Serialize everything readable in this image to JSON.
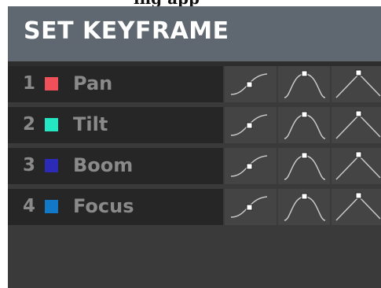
{
  "top_fragment": "ing app",
  "panel": {
    "title": "SET KEYFRAME"
  },
  "channels": [
    {
      "number": "1",
      "name": "Pan",
      "color": "#f0505a"
    },
    {
      "number": "2",
      "name": "Tilt",
      "color": "#24e6c3"
    },
    {
      "number": "3",
      "name": "Boom",
      "color": "#2b2bb8"
    },
    {
      "number": "4",
      "name": "Focus",
      "color": "#1278c8"
    }
  ],
  "curve_buttons": [
    {
      "icon": "ease-in-curve-icon"
    },
    {
      "icon": "bell-curve-icon"
    },
    {
      "icon": "peak-linear-icon"
    }
  ]
}
